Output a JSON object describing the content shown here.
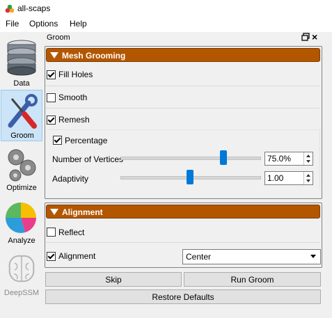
{
  "window": {
    "title": "all-scaps"
  },
  "menu": [
    "File",
    "Options",
    "Help"
  ],
  "toolbar": {
    "items": [
      {
        "label": "Data"
      },
      {
        "label": "Groom"
      },
      {
        "label": "Optimize"
      },
      {
        "label": "Analyze"
      },
      {
        "label": "DeepSSM"
      }
    ],
    "active": "Groom"
  },
  "dock": {
    "title": "Groom"
  },
  "mesh_grooming": {
    "title": "Mesh Grooming",
    "fill_holes": {
      "label": "Fill Holes",
      "checked": true
    },
    "smooth": {
      "label": "Smooth",
      "checked": false
    },
    "remesh": {
      "label": "Remesh",
      "checked": true
    },
    "percentage": {
      "label": "Percentage",
      "checked": true
    },
    "num_vertices": {
      "label": "Number of Vertices",
      "value": "75.0%",
      "slider_fraction": 0.75
    },
    "adaptivity": {
      "label": "Adaptivity",
      "value": "1.00",
      "slider_fraction": 0.5
    }
  },
  "alignment": {
    "title": "Alignment",
    "reflect": {
      "label": "Reflect",
      "checked": false
    },
    "alignment": {
      "label": "Alignment",
      "checked": true,
      "selected": "Center"
    }
  },
  "buttons": {
    "skip": "Skip",
    "run": "Run Groom",
    "restore": "Restore Defaults"
  },
  "colors": {
    "section_header": "#b35600",
    "slider_handle": "#0078d7",
    "active_tool": "#cce4f7"
  }
}
